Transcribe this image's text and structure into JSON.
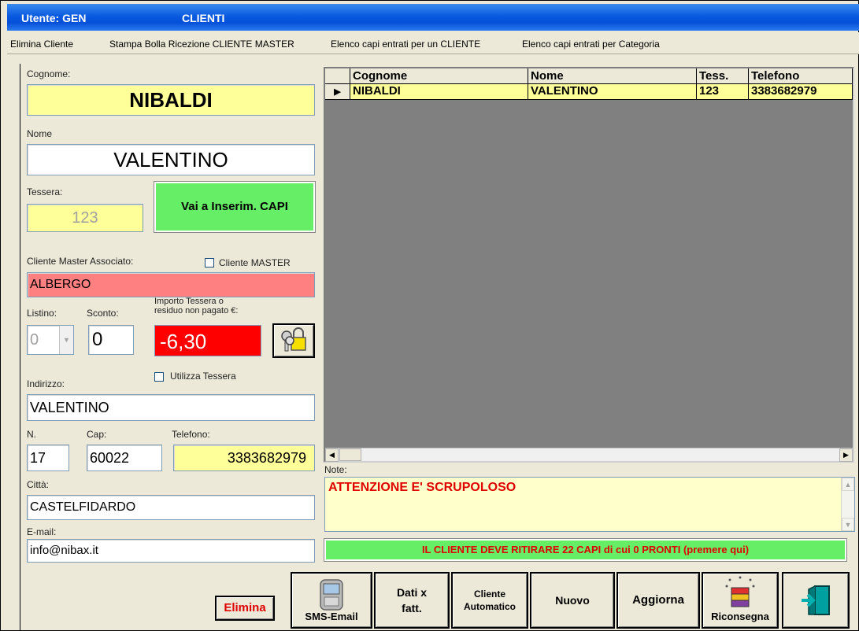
{
  "window": {
    "user_label": "Utente: GEN",
    "app_title": "CLIENTI"
  },
  "menu": [
    "Elimina Cliente",
    "Stampa Bolla Ricezione CLIENTE MASTER",
    "Elenco capi entrati per un CLIENTE",
    "Elenco capi entrati per Categoria"
  ],
  "form": {
    "cognome_label": "Cognome:",
    "cognome": "NIBALDI",
    "nome_label": "Nome",
    "nome": "VALENTINO",
    "tessera_label": "Tessera:",
    "tessera": "123",
    "vai_button": "Vai a Inserim. CAPI",
    "cliente_master_label": "Cliente Master Associato:",
    "cliente_master_checkbox": "Cliente MASTER",
    "cliente_master": "ALBERGO",
    "listino_label": "Listino:",
    "listino": "0",
    "sconto_label": "Sconto:",
    "sconto": "0",
    "importo_label_1": "Importo Tessera o",
    "importo_label_2": "residuo non pagato €:",
    "importo": "-6,30",
    "utilizza_tessera": "Utilizza Tessera",
    "indirizzo_label": "Indirizzo:",
    "indirizzo": "VALENTINO",
    "n_label": "N.",
    "n": "17",
    "cap_label": "Cap:",
    "cap": "60022",
    "telefono_label": "Telefono:",
    "telefono": "3383682979",
    "citta_label": "Città:",
    "citta": "CASTELFIDARDO",
    "email_label": "E-mail:",
    "email": "info@nibax.it"
  },
  "grid": {
    "columns": [
      "Cognome",
      "Nome",
      "Tess.",
      "Telefono"
    ],
    "rows": [
      [
        "NIBALDI",
        "VALENTINO",
        "123",
        "3383682979"
      ]
    ]
  },
  "notes": {
    "label": "Note:",
    "text": "ATTENZIONE E' SCRUPOLOSO"
  },
  "banner": "IL CLIENTE DEVE RITIRARE 22 CAPI di cui 0 PRONTI  (premere qui)",
  "buttons": {
    "elimina": "Elimina",
    "sms_email": "SMS-Email",
    "dati_fatt_1": "Dati x",
    "dati_fatt_2": "fatt.",
    "cliente_auto_1": "Cliente",
    "cliente_auto_2": "Automatico",
    "nuovo": "Nuovo",
    "aggiorna": "Aggiorna",
    "riconsegna": "Riconsegna"
  },
  "colors": {
    "titlebar": "#0a5ae0",
    "highlight_yellow": "#ffff99",
    "green": "#66ee66",
    "alert_red": "#ff0000",
    "pink": "#ff8080"
  }
}
